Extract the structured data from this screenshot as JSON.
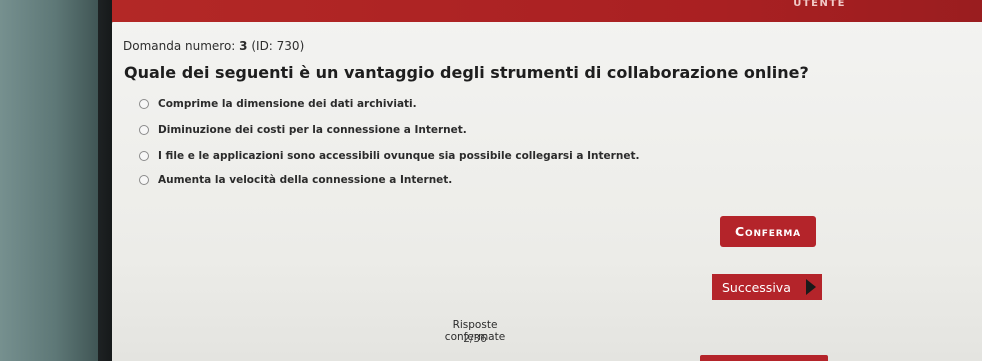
{
  "header": {
    "user_label": "UTENTE",
    "accent_color": "#b32826"
  },
  "question": {
    "number_prefix": "Domanda numero: ",
    "number": "3",
    "id_text": " (ID: 730)",
    "text": "Quale dei seguenti è un vantaggio degli strumenti di collaborazione online?"
  },
  "options": [
    {
      "label": "Comprime la dimensione dei dati archiviati."
    },
    {
      "label": "Diminuzione dei costi per la connessione a Internet."
    },
    {
      "label": "I file e le applicazioni sono accessibili ovunque sia possibile collegarsi a Internet."
    },
    {
      "label": "Aumenta la velocità della connessione a Internet."
    }
  ],
  "actions": {
    "confirm_label": "Conferma",
    "next_label": "Successiva",
    "next_icon": "play-arrow-icon"
  },
  "status": {
    "confirmed_label": "Risposte confermate",
    "confirmed_count": "2/36"
  }
}
